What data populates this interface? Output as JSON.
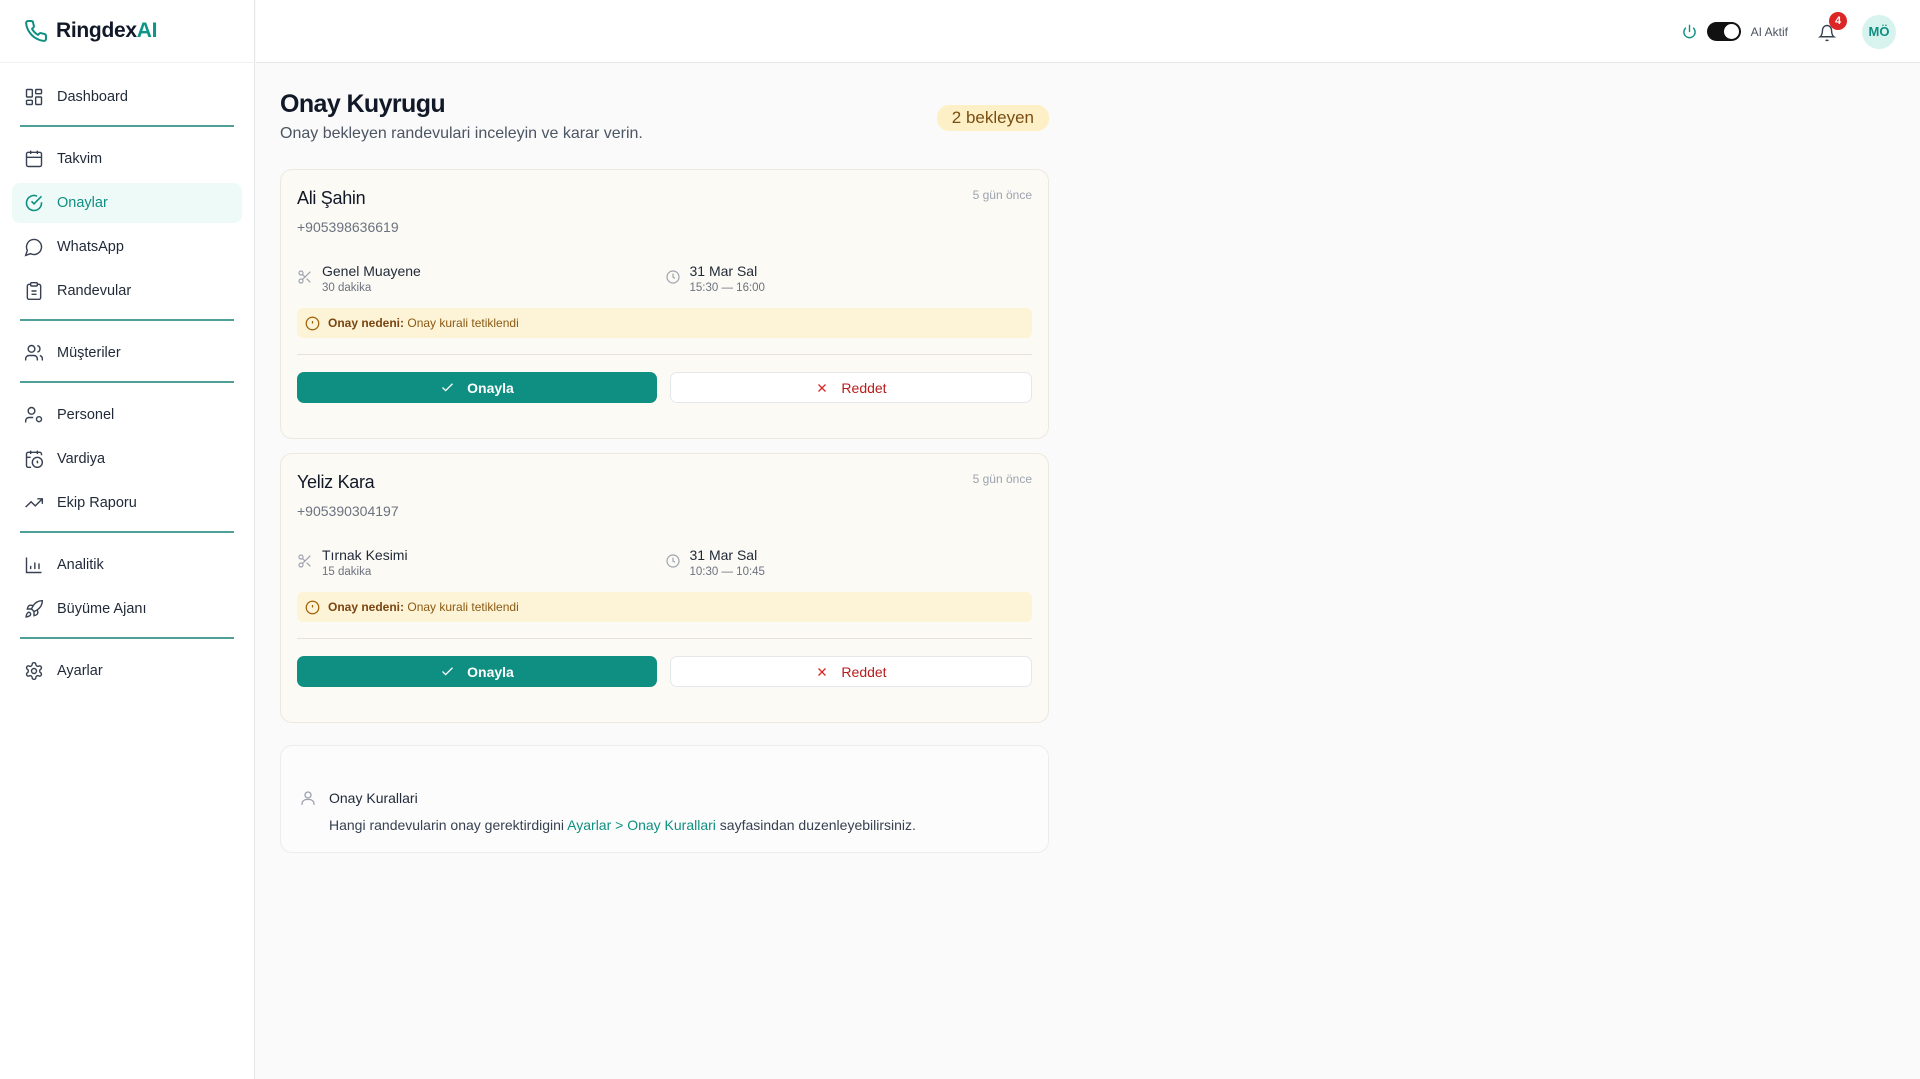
{
  "brand": {
    "name_main": "Ringdex",
    "name_accent": "AI"
  },
  "sidebar": {
    "items": [
      {
        "label": "Dashboard",
        "icon": "grid-icon"
      },
      {
        "label": "Takvim",
        "icon": "calendar-icon"
      },
      {
        "label": "Onaylar",
        "icon": "check-circle-icon",
        "active": true
      },
      {
        "label": "WhatsApp",
        "icon": "chat-icon"
      },
      {
        "label": "Randevular",
        "icon": "clipboard-icon"
      },
      {
        "label": "Müşteriler",
        "icon": "users-icon"
      },
      {
        "label": "Personel",
        "icon": "user-cog-icon"
      },
      {
        "label": "Vardiya",
        "icon": "calendar-clock-icon"
      },
      {
        "label": "Ekip Raporu",
        "icon": "trending-up-icon"
      },
      {
        "label": "Analitik",
        "icon": "bar-chart-icon"
      },
      {
        "label": "Büyüme Ajanı",
        "icon": "rocket-icon"
      },
      {
        "label": "Ayarlar",
        "icon": "gear-icon"
      }
    ]
  },
  "topbar": {
    "ai_label": "AI Aktif",
    "notification_count": "4",
    "avatar_initials": "MÖ"
  },
  "page": {
    "title": "Onay Kuyrugu",
    "subtitle": "Onay bekleyen randevulari inceleyin ve karar verin.",
    "pending_badge": "2 bekleyen"
  },
  "requests": [
    {
      "name": "Ali Şahin",
      "phone": "+905398636619",
      "ago": "5 gün önce",
      "service": "Genel Muayene",
      "duration": "30 dakika",
      "date": "31 Mar Sal",
      "time": "15:30 — 16:00",
      "reason_label": "Onay nedeni:",
      "reason_text": "Onay kurali tetiklendi",
      "approve_label": "Onayla",
      "reject_label": "Reddet"
    },
    {
      "name": "Yeliz Kara",
      "phone": "+905390304197",
      "ago": "5 gün önce",
      "service": "Tırnak Kesimi",
      "duration": "15 dakika",
      "date": "31 Mar Sal",
      "time": "10:30 — 10:45",
      "reason_label": "Onay nedeni:",
      "reason_text": "Onay kurali tetiklendi",
      "approve_label": "Onayla",
      "reject_label": "Reddet"
    }
  ],
  "rules": {
    "title": "Onay Kurallari",
    "text_before": "Hangi randevularin onay gerektirdigini",
    "link": "Ayarlar > Onay Kurallari",
    "text_after": "sayfasindan duzenleyebilirsiniz."
  },
  "colors": {
    "accent": "#0f8f82",
    "danger": "#b91c1c",
    "warning_bg": "#fdf3d6"
  }
}
